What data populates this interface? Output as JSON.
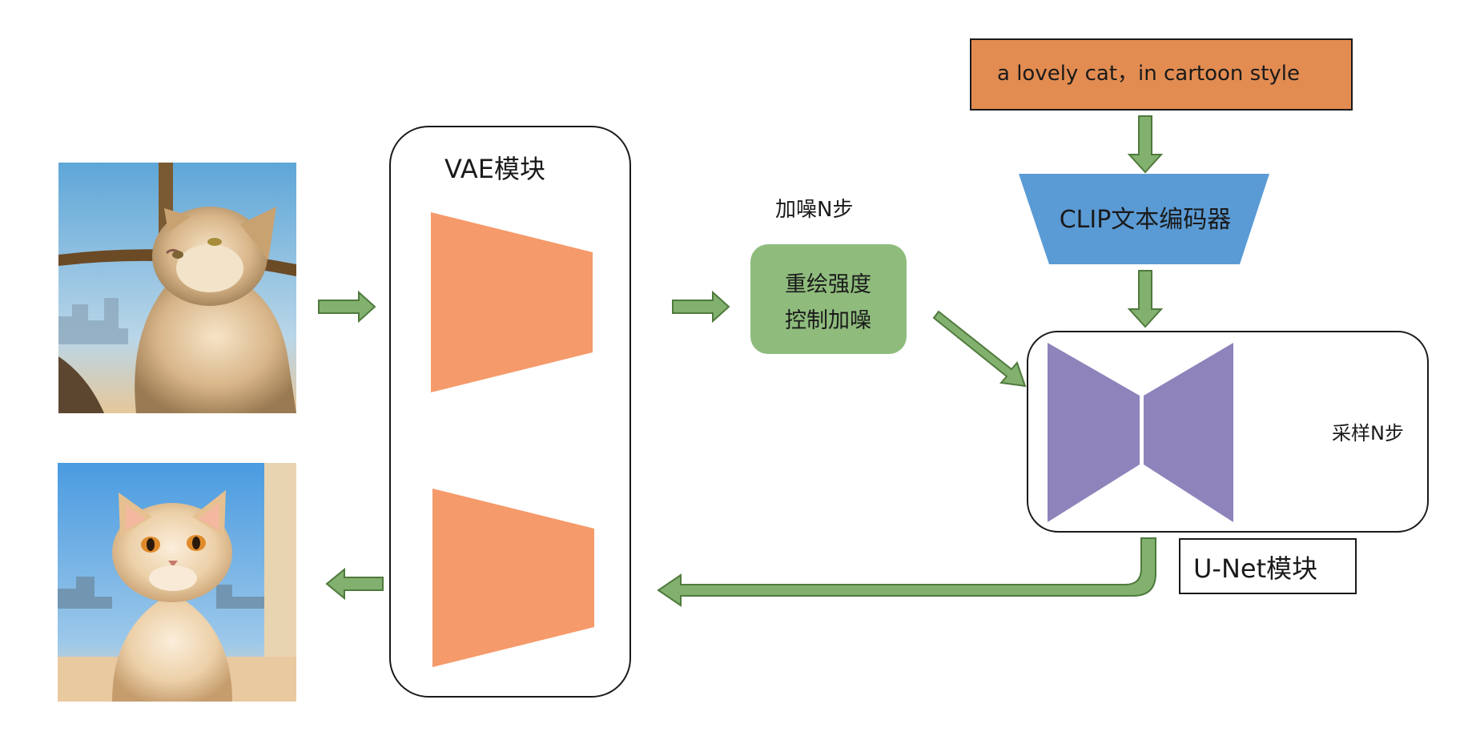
{
  "vae": {
    "title": "VAE模块"
  },
  "noise": {
    "top_label": "加噪N步",
    "box_line1": "重绘强度",
    "box_line2": "控制加噪"
  },
  "prompt": {
    "text": "a lovely cat，in cartoon style"
  },
  "clip": {
    "label": "CLIP文本编码器"
  },
  "unet": {
    "label": "U-Net模块",
    "sampling_label": "采样N步"
  },
  "images": {
    "input_photo": "photo of a cat looking up by a window",
    "output_photo": "cartoon-style cat by a window"
  },
  "colors": {
    "arrow": "#82b06e",
    "arrow_stroke": "#4f7a3d",
    "vae_shape": "#f59a6a",
    "noise_box": "#8fbc7d",
    "prompt_box": "#e28c52",
    "clip_shape": "#5b9bd5",
    "unet_shape": "#8f83bb"
  }
}
